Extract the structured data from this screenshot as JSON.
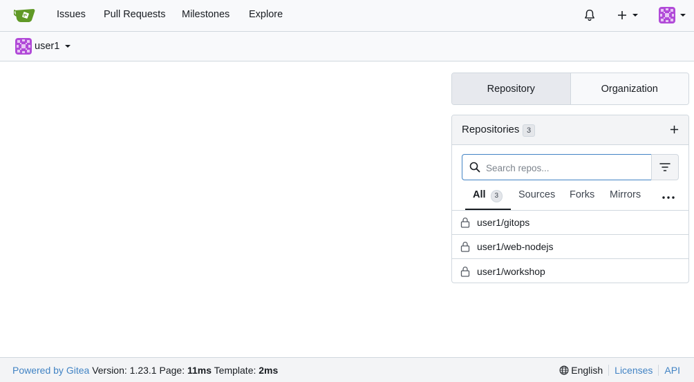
{
  "nav": {
    "items": [
      {
        "label": "Issues"
      },
      {
        "label": "Pull Requests"
      },
      {
        "label": "Milestones"
      },
      {
        "label": "Explore"
      }
    ],
    "icons": {
      "notifications": "bell-icon",
      "create": "plus-icon",
      "user_menu": "avatar"
    }
  },
  "context": {
    "user": "user1"
  },
  "switcher": {
    "repository": "Repository",
    "organization": "Organization"
  },
  "repos": {
    "title": "Repositories",
    "count": "3",
    "search_placeholder": "Search repos...",
    "tabs": [
      {
        "label": "All",
        "count": "3"
      },
      {
        "label": "Sources"
      },
      {
        "label": "Forks"
      },
      {
        "label": "Mirrors"
      }
    ],
    "items": [
      {
        "name": "user1/gitops"
      },
      {
        "name": "user1/web-nodejs"
      },
      {
        "name": "user1/workshop"
      }
    ]
  },
  "footer": {
    "powered_by": "Powered by Gitea",
    "version_label": "Version:",
    "version": "1.23.1",
    "page_label": "Page:",
    "page_time": "11ms",
    "template_label": "Template:",
    "template_time": "2ms",
    "language": "English",
    "licenses": "Licenses",
    "api": "API"
  },
  "colors": {
    "accent": "#4183c4",
    "logo_green": "#609926",
    "avatar_purple": "#b14ad8"
  }
}
